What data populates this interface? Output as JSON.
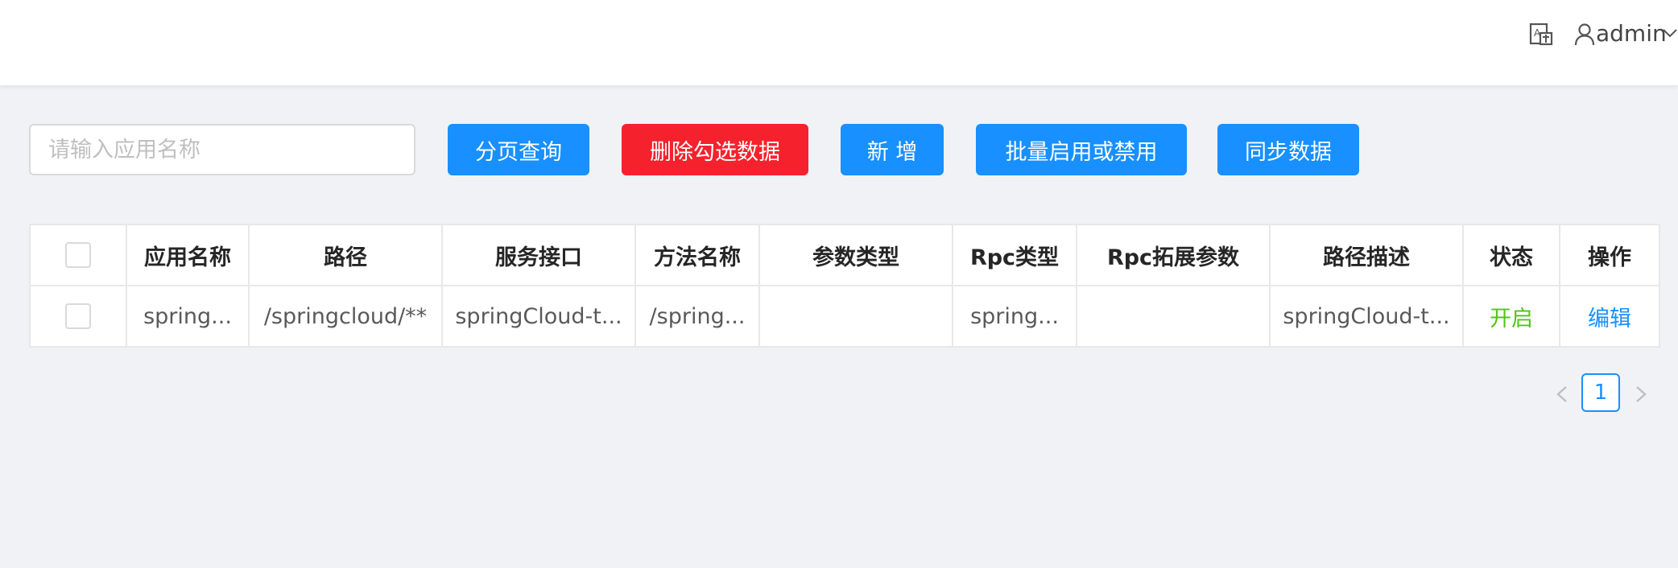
{
  "header": {
    "username": "admin",
    "icons": [
      "translate-icon",
      "user-icon",
      "chevron-down-icon"
    ]
  },
  "toolbar": {
    "search_placeholder": "请输入应用名称",
    "search_value": "",
    "query_label": "分页查询",
    "delete_label": "删除勾选数据",
    "add_label": "新 增",
    "batch_label": "批量启用或禁用",
    "sync_label": "同步数据"
  },
  "table": {
    "columns": [
      "应用名称",
      "路径",
      "服务接口",
      "方法名称",
      "参数类型",
      "Rpc类型",
      "Rpc拓展参数",
      "路径描述",
      "状态",
      "操作"
    ],
    "rows": [
      {
        "app_name": "spring...",
        "path": "/springcloud/**",
        "service_interface": "springCloud-t...",
        "method_name": "/spring...",
        "param_types": "",
        "rpc_type": "spring...",
        "rpc_ext": "",
        "path_desc": "springCloud-t...",
        "status": "开启",
        "action": "编辑"
      }
    ]
  },
  "pagination": {
    "current_page": "1"
  },
  "colors": {
    "primary": "#1890ff",
    "danger": "#f5222d",
    "status_on": "#52c41a",
    "background": "#f0f2f5"
  }
}
